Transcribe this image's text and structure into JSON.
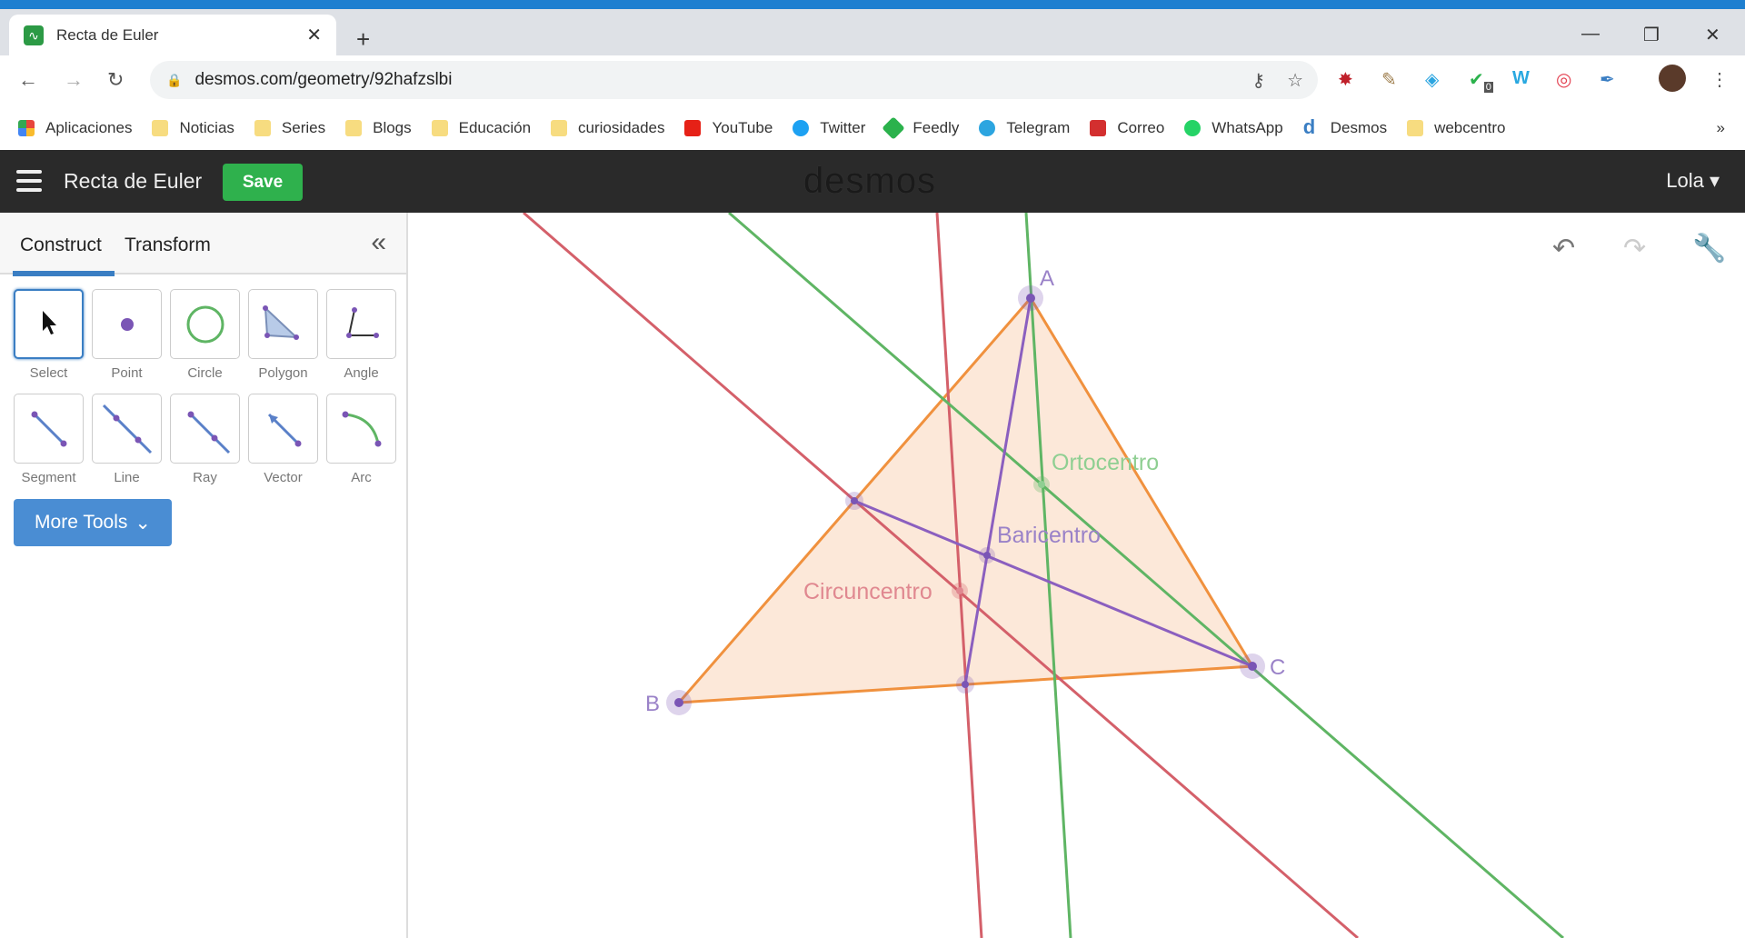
{
  "browser": {
    "tab_title": "Recta de Euler",
    "url": "desmos.com/geometry/92hafzslbi",
    "extension_badge": "0",
    "bookmarks": [
      {
        "label": "Aplicaciones",
        "color": "#e8453c"
      },
      {
        "label": "Noticias",
        "color": "#f7dc80"
      },
      {
        "label": "Series",
        "color": "#f7dc80"
      },
      {
        "label": "Blogs",
        "color": "#f7dc80"
      },
      {
        "label": "Educación",
        "color": "#f7dc80"
      },
      {
        "label": "curiosidades",
        "color": "#f7dc80"
      },
      {
        "label": "YouTube",
        "color": "#e62117"
      },
      {
        "label": "Twitter",
        "color": "#1da1f2"
      },
      {
        "label": "Feedly",
        "color": "#2bb24c"
      },
      {
        "label": "Telegram",
        "color": "#2ca5e0"
      },
      {
        "label": "Correo",
        "color": "#d32f2f"
      },
      {
        "label": "WhatsApp",
        "color": "#25d366"
      },
      {
        "label": "Desmos",
        "color": "#3a7ec3"
      },
      {
        "label": "webcentro",
        "color": "#f7dc80"
      }
    ],
    "overflow": "»"
  },
  "header": {
    "title": "Recta de Euler",
    "save": "Save",
    "logo": "desmos",
    "user": "Lola ▾"
  },
  "sidebar": {
    "tabs": [
      "Construct",
      "Transform"
    ],
    "collapse": "«",
    "tools": [
      "Select",
      "Point",
      "Circle",
      "Polygon",
      "Angle",
      "Segment",
      "Line",
      "Ray",
      "Vector",
      "Arc"
    ],
    "more_tools": "More Tools"
  },
  "canvas": {
    "labels": {
      "A": "A",
      "B": "B",
      "C": "C",
      "ortho": "Ortocentro",
      "bari": "Baricentro",
      "circ": "Circuncentro"
    },
    "colors": {
      "triangle": "#f0913e",
      "fill": "#fbe0cc",
      "red": "#d4606a",
      "green": "#5fb564",
      "purple": "#8b5fbf",
      "point": "#7a55b5"
    }
  }
}
